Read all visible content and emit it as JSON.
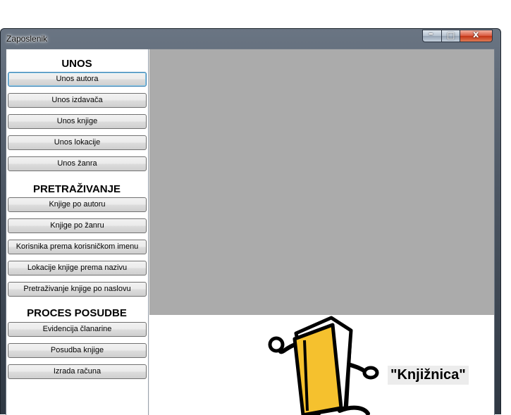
{
  "window": {
    "title": "Zaposlenik",
    "controls": {
      "minimize": "–",
      "maximize": "□",
      "close": "x"
    }
  },
  "sidebar": {
    "sections": [
      {
        "title": "UNOS",
        "buttons": [
          "Unos autora",
          "Unos izdavača",
          "Unos knjige",
          "Unos lokacije",
          "Unos žanra"
        ]
      },
      {
        "title": "PRETRAŽIVANJE",
        "buttons": [
          "Knjige po autoru",
          "Knjige po žanru",
          "Korisnika prema korisničkom imenu",
          "Lokacije knjige prema nazivu",
          "Pretraživanje knjige po naslovu"
        ]
      },
      {
        "title": "PROCES POSUDBE",
        "buttons": [
          "Evidencija članarine",
          "Posudba knjige",
          "Izrada računa"
        ]
      }
    ]
  },
  "main": {
    "brand_text": "\"Knjižnica\"",
    "logo_icon": "walking-book-icon",
    "colors": {
      "panel": "#ababab",
      "book": "#f5c12e"
    }
  }
}
